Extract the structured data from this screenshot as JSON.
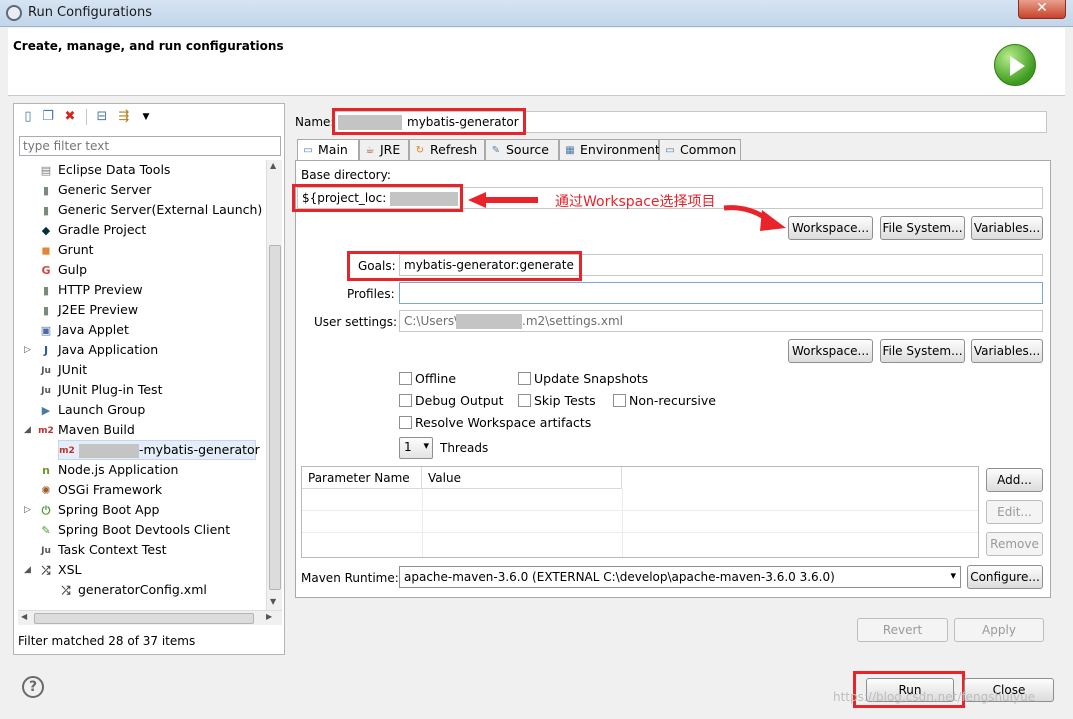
{
  "window": {
    "title": "Run Configurations",
    "close_glyph": "✕",
    "banner_text": "Create, manage, and run configurations"
  },
  "left": {
    "filter_placeholder": "type filter text",
    "items": [
      {
        "label": "Eclipse Data Tools",
        "icon": "database-icon",
        "glyph": "▤",
        "color": "#7a7a7a"
      },
      {
        "label": "Generic Server",
        "icon": "server-icon",
        "glyph": "▮",
        "color": "#7a8a7a"
      },
      {
        "label": "Generic Server(External Launch)",
        "icon": "server-icon",
        "glyph": "▮",
        "color": "#7a8a7a"
      },
      {
        "label": "Gradle Project",
        "icon": "gradle-icon",
        "glyph": "◆",
        "color": "#02303a"
      },
      {
        "label": "Grunt",
        "icon": "grunt-icon",
        "glyph": "◼",
        "color": "#e48632"
      },
      {
        "label": "Gulp",
        "icon": "gulp-icon",
        "glyph": "G",
        "color": "#cf4647"
      },
      {
        "label": "HTTP Preview",
        "icon": "server-icon",
        "glyph": "▮",
        "color": "#7a8a7a"
      },
      {
        "label": "J2EE Preview",
        "icon": "server-icon",
        "glyph": "▮",
        "color": "#7a8a7a"
      },
      {
        "label": "Java Applet",
        "icon": "applet-icon",
        "glyph": "▣",
        "color": "#4a6aa5"
      },
      {
        "label": "Java Application",
        "icon": "java-app-icon",
        "glyph": "J",
        "color": "#2d5aa0"
      },
      {
        "label": "JUnit",
        "icon": "junit-icon",
        "glyph": "Ju",
        "color": "#555555"
      },
      {
        "label": "JUnit Plug-in Test",
        "icon": "junit-plugin-icon",
        "glyph": "Ju",
        "color": "#555555"
      },
      {
        "label": "Launch Group",
        "icon": "launch-group-icon",
        "glyph": "▶",
        "color": "#4a7aa5"
      },
      {
        "label": "Maven Build",
        "icon": "maven-icon",
        "glyph": "m2",
        "color": "#c0302b"
      },
      {
        "label": "-mybatis-generator",
        "icon": "maven-icon",
        "glyph": "m2",
        "color": "#c0302b"
      },
      {
        "label": "Node.js Application",
        "icon": "nodejs-icon",
        "glyph": "n",
        "color": "#6b9b2e"
      },
      {
        "label": "OSGi Framework",
        "icon": "osgi-icon",
        "glyph": "✺",
        "color": "#a05a20"
      },
      {
        "label": "Spring Boot App",
        "icon": "spring-boot-icon",
        "glyph": "⏻",
        "color": "#4a9b2e"
      },
      {
        "label": "Spring Boot Devtools Client",
        "icon": "spring-devtools-icon",
        "glyph": "✎",
        "color": "#4a9b2e"
      },
      {
        "label": "Task Context Test",
        "icon": "task-context-icon",
        "glyph": "Ju",
        "color": "#555555"
      },
      {
        "label": "XSL",
        "icon": "xsl-icon",
        "glyph": "⤮",
        "color": "#444444"
      },
      {
        "label": "generatorConfig.xml",
        "icon": "xsl-icon",
        "glyph": "⤮",
        "color": "#444444"
      }
    ],
    "status": "Filter matched 28 of 37 items"
  },
  "main": {
    "name_label": "Name:",
    "name_value": "mybatis-generator",
    "tabs": [
      {
        "label": "Main",
        "icon": "main-tab-icon",
        "glyph": "▭"
      },
      {
        "label": "JRE",
        "icon": "jre-icon",
        "glyph": "☕"
      },
      {
        "label": "Refresh",
        "icon": "refresh-icon",
        "glyph": "↻"
      },
      {
        "label": "Source",
        "icon": "source-icon",
        "glyph": "✎"
      },
      {
        "label": "Environment",
        "icon": "environment-icon",
        "glyph": "▦"
      },
      {
        "label": "Common",
        "icon": "common-icon",
        "glyph": "▭"
      }
    ],
    "base_dir_label": "Base directory:",
    "base_dir_value": "${project_loc:",
    "annotation": "通过Workspace选择项目",
    "workspace_button": "Workspace...",
    "file_system_button": "File System...",
    "variables_button": "Variables...",
    "goals_label": "Goals:",
    "goals_value": "mybatis-generator:generate",
    "profiles_label": "Profiles:",
    "profiles_value": "",
    "user_settings_label": "User settings:",
    "user_settings_prefix": "C:\\Users\\",
    "user_settings_suffix": ".m2\\settings.xml",
    "options": {
      "offline": "Offline",
      "update_snapshots": "Update Snapshots",
      "debug_output": "Debug Output",
      "skip_tests": "Skip Tests",
      "non_recursive": "Non-recursive",
      "resolve_workspace": "Resolve Workspace artifacts"
    },
    "threads_value": "1",
    "threads_label": "Threads",
    "param_headers": [
      "Parameter Name",
      "Value"
    ],
    "add_button": "Add...",
    "edit_button": "Edit...",
    "remove_button": "Remove",
    "runtime_label": "Maven Runtime:",
    "runtime_value": "apache-maven-3.6.0 (EXTERNAL C:\\develop\\apache-maven-3.6.0 3.6.0)",
    "configure_button": "Configure...",
    "revert_button": "Revert",
    "apply_button": "Apply"
  },
  "footer": {
    "help_glyph": "?",
    "run_button": "Run",
    "close_button": "Close",
    "watermark": "https://blog.csdn.net/fengshuiyue"
  },
  "colors": {
    "annotation_red": "#e8232a",
    "selected_item_bg": "#e5eef8"
  }
}
